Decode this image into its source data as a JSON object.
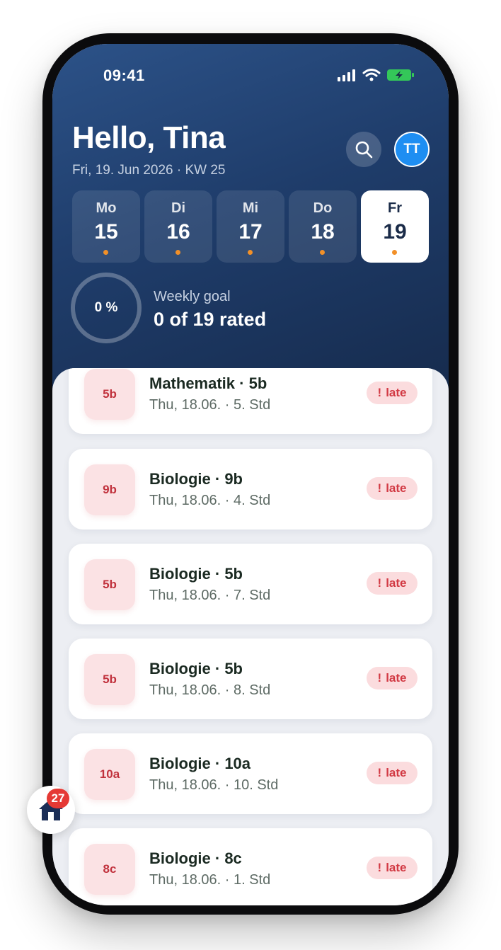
{
  "status": {
    "time": "09:41"
  },
  "header": {
    "greeting": "Hello, Tina",
    "date_line": "Fri, 19. Jun 2026 · KW 25",
    "avatar_initials": "TT"
  },
  "week": {
    "days": [
      {
        "name": "Mo",
        "num": "15",
        "active": false
      },
      {
        "name": "Di",
        "num": "16",
        "active": false
      },
      {
        "name": "Mi",
        "num": "17",
        "active": false
      },
      {
        "name": "Do",
        "num": "18",
        "active": false
      },
      {
        "name": "Fr",
        "num": "19",
        "active": true
      }
    ]
  },
  "goal": {
    "percent_text": "0 %",
    "label": "Weekly goal",
    "value": "0 of 19 rated",
    "progress": 0
  },
  "lessons": [
    {
      "class": "5b",
      "title": "Mathematik · 5b",
      "sub": "Thu, 18.06. · 5. Std",
      "badge": "late"
    },
    {
      "class": "9b",
      "title": "Biologie · 9b",
      "sub": "Thu, 18.06. · 4. Std",
      "badge": "late"
    },
    {
      "class": "5b",
      "title": "Biologie · 5b",
      "sub": "Thu, 18.06. · 7. Std",
      "badge": "late"
    },
    {
      "class": "5b",
      "title": "Biologie · 5b",
      "sub": "Thu, 18.06. · 8. Std",
      "badge": "late"
    },
    {
      "class": "10a",
      "title": "Biologie · 10a",
      "sub": "Thu, 18.06. · 10. Std",
      "badge": "late"
    },
    {
      "class": "8c",
      "title": "Biologie · 8c",
      "sub": "Thu, 18.06. · 1. Std",
      "badge": "late"
    }
  ],
  "badge_icon": "exclamation-icon",
  "fab": {
    "icon": "home-icon",
    "count": "27"
  },
  "colors": {
    "accent": "#1e8ef2",
    "late": "#d23a44",
    "dot": "#f29028",
    "header": "#1f3d6b"
  }
}
